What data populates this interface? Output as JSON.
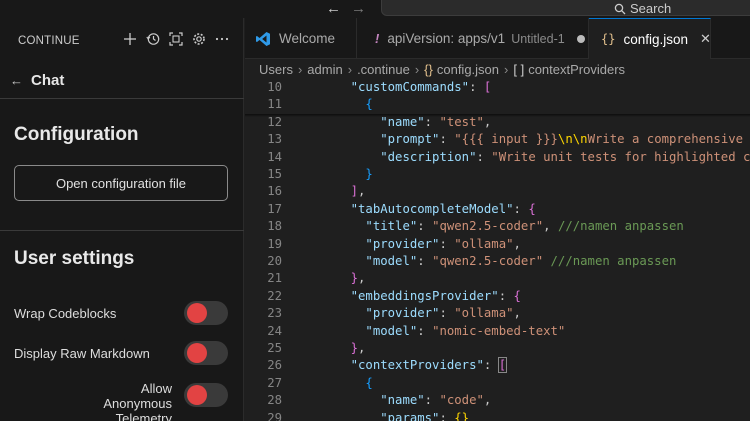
{
  "titlebar": {
    "back_arrow": "←",
    "forward_arrow": "→",
    "search_label": "Search"
  },
  "sidebar": {
    "header": "CONTINUE",
    "actions": [
      "plus-icon",
      "history-icon",
      "fullscreen-icon",
      "gear-icon",
      "more-icon"
    ],
    "chat_back": "←",
    "chat_title": "Chat",
    "config_title": "Configuration",
    "open_config_label": "Open configuration file",
    "user_settings_title": "User settings",
    "settings": [
      {
        "label": "Wrap Codeblocks",
        "enabled": false
      },
      {
        "label": "Display Raw Markdown",
        "enabled": false
      },
      {
        "label_line1": "Allow Anonymous",
        "label_line2": "Telemetry",
        "enabled": false
      }
    ],
    "toggle_color": "#e24343"
  },
  "tabs": [
    {
      "label": "Welcome",
      "icon": "vscode-icon"
    },
    {
      "label": "apiVersion: apps/v1",
      "suffix": "Untitled-1",
      "icon": "exclamation-icon",
      "modified": true
    },
    {
      "label": "config.json",
      "icon": "braces-icon",
      "active": true,
      "close": "✕"
    }
  ],
  "breadcrumb": [
    "Users",
    "admin",
    ".continue",
    "config.json",
    "contextProviders"
  ],
  "breadcrumb_icons": {
    "json": "{}",
    "array": "[ ]"
  },
  "code": {
    "lines": [
      {
        "n": "10",
        "parts": [
          [
            "",
            "    "
          ],
          [
            "k",
            "\"customCommands\""
          ],
          [
            "",
            ": "
          ],
          [
            "b2",
            "["
          ]
        ]
      },
      {
        "n": "11",
        "parts": [
          [
            "",
            "      "
          ],
          [
            "b3",
            "{"
          ]
        ]
      },
      {
        "n": "12",
        "parts": [
          [
            "",
            "        "
          ],
          [
            "k",
            "\"name\""
          ],
          [
            "",
            ": "
          ],
          [
            "s",
            "\"test\""
          ],
          [
            "",
            ","
          ]
        ]
      },
      {
        "n": "13",
        "parts": [
          [
            "",
            "        "
          ],
          [
            "k",
            "\"prompt\""
          ],
          [
            "",
            ": "
          ],
          [
            "s",
            "\"{{{ input }}}"
          ],
          [
            "b1",
            "\\n\\n"
          ],
          [
            "s",
            "Write a comprehensive set of u"
          ]
        ]
      },
      {
        "n": "14",
        "parts": [
          [
            "",
            "        "
          ],
          [
            "k",
            "\"description\""
          ],
          [
            "",
            ": "
          ],
          [
            "s",
            "\"Write unit tests for highlighted code\""
          ]
        ]
      },
      {
        "n": "15",
        "parts": [
          [
            "",
            "      "
          ],
          [
            "b3",
            "}"
          ]
        ]
      },
      {
        "n": "16",
        "parts": [
          [
            "",
            "    "
          ],
          [
            "b2",
            "]"
          ],
          [
            "",
            ","
          ]
        ]
      },
      {
        "n": "17",
        "parts": [
          [
            "",
            "    "
          ],
          [
            "k",
            "\"tabAutocompleteModel\""
          ],
          [
            "",
            ": "
          ],
          [
            "b2",
            "{"
          ]
        ]
      },
      {
        "n": "18",
        "parts": [
          [
            "",
            "      "
          ],
          [
            "k",
            "\"title\""
          ],
          [
            "",
            ": "
          ],
          [
            "s",
            "\"qwen2.5-coder\""
          ],
          [
            "",
            ", "
          ],
          [
            "c",
            "///namen anpassen"
          ]
        ]
      },
      {
        "n": "19",
        "parts": [
          [
            "",
            "      "
          ],
          [
            "k",
            "\"provider\""
          ],
          [
            "",
            ": "
          ],
          [
            "s",
            "\"ollama\""
          ],
          [
            "",
            ","
          ]
        ]
      },
      {
        "n": "20",
        "parts": [
          [
            "",
            "      "
          ],
          [
            "k",
            "\"model\""
          ],
          [
            "",
            ": "
          ],
          [
            "s",
            "\"qwen2.5-coder\""
          ],
          [
            "",
            " "
          ],
          [
            "c",
            "///namen anpassen"
          ]
        ]
      },
      {
        "n": "21",
        "parts": [
          [
            "",
            "    "
          ],
          [
            "b2",
            "}"
          ],
          [
            "",
            ","
          ]
        ]
      },
      {
        "n": "22",
        "parts": [
          [
            "",
            "    "
          ],
          [
            "k",
            "\"embeddingsProvider\""
          ],
          [
            "",
            ": "
          ],
          [
            "b2",
            "{"
          ]
        ]
      },
      {
        "n": "23",
        "parts": [
          [
            "",
            "      "
          ],
          [
            "k",
            "\"provider\""
          ],
          [
            "",
            ": "
          ],
          [
            "s",
            "\"ollama\""
          ],
          [
            "",
            ","
          ]
        ]
      },
      {
        "n": "24",
        "parts": [
          [
            "",
            "      "
          ],
          [
            "k",
            "\"model\""
          ],
          [
            "",
            ": "
          ],
          [
            "s",
            "\"nomic-embed-text\""
          ]
        ]
      },
      {
        "n": "25",
        "parts": [
          [
            "",
            "    "
          ],
          [
            "b2",
            "}"
          ],
          [
            "",
            ","
          ]
        ]
      },
      {
        "n": "26",
        "parts": [
          [
            "",
            "    "
          ],
          [
            "k",
            "\"contextProviders\""
          ],
          [
            "",
            ": "
          ],
          [
            "b2 hl",
            "["
          ]
        ]
      },
      {
        "n": "27",
        "parts": [
          [
            "",
            "      "
          ],
          [
            "b3",
            "{"
          ]
        ]
      },
      {
        "n": "28",
        "parts": [
          [
            "",
            "        "
          ],
          [
            "k",
            "\"name\""
          ],
          [
            "",
            ": "
          ],
          [
            "s",
            "\"code\""
          ],
          [
            "",
            ","
          ]
        ]
      },
      {
        "n": "29",
        "parts": [
          [
            "",
            "        "
          ],
          [
            "k",
            "\"params\""
          ],
          [
            "",
            ": "
          ],
          [
            "b1",
            "{}"
          ]
        ]
      }
    ]
  }
}
